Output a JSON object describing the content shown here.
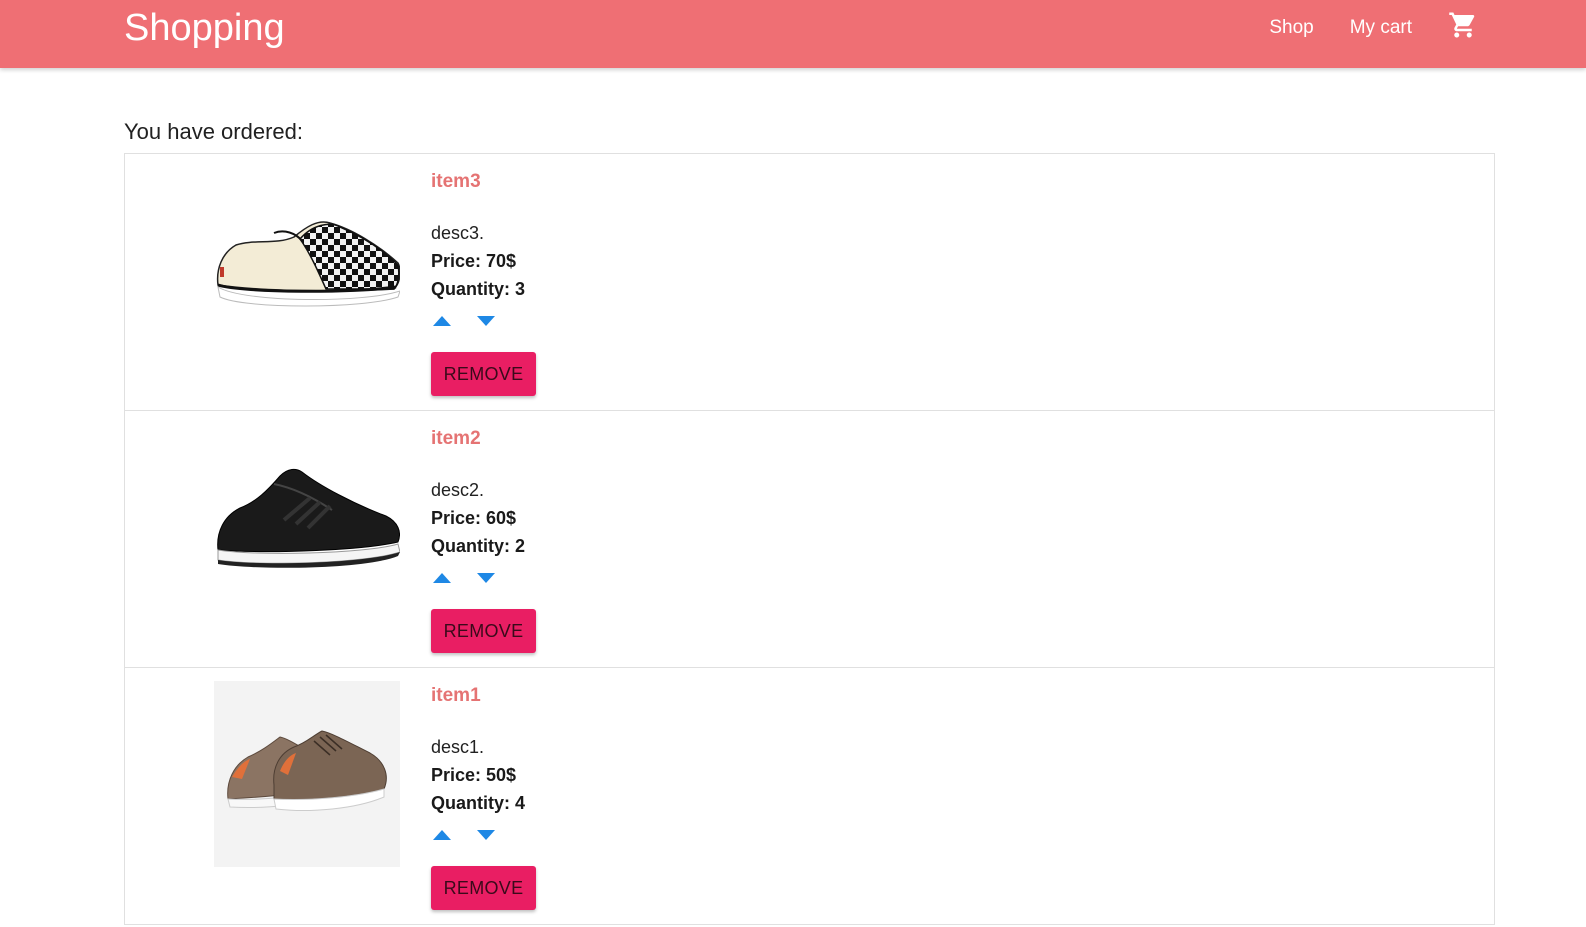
{
  "navbar": {
    "brand": "Shopping",
    "links": [
      {
        "label": "Shop"
      },
      {
        "label": "My cart"
      }
    ],
    "cart_icon": "shopping-cart-icon",
    "background_color": "#ef6f74"
  },
  "main": {
    "heading": "You have ordered:",
    "items": [
      {
        "title": "item3",
        "description": "desc3.",
        "price": "Price: 70$",
        "quantity": "Quantity: 3",
        "remove_label": "REMOVE",
        "image": "checkered-slip-on-shoe"
      },
      {
        "title": "item2",
        "description": "desc2.",
        "price": "Price: 60$",
        "quantity": "Quantity: 2",
        "remove_label": "REMOVE",
        "image": "black-running-shoe"
      },
      {
        "title": "item1",
        "description": "desc1.",
        "price": "Price: 50$",
        "quantity": "Quantity: 4",
        "remove_label": "REMOVE",
        "image": "brown-suede-sneakers"
      }
    ]
  },
  "colors": {
    "accent": "#e91e63",
    "title": "#e57373",
    "arrow": "#1e88e5"
  }
}
